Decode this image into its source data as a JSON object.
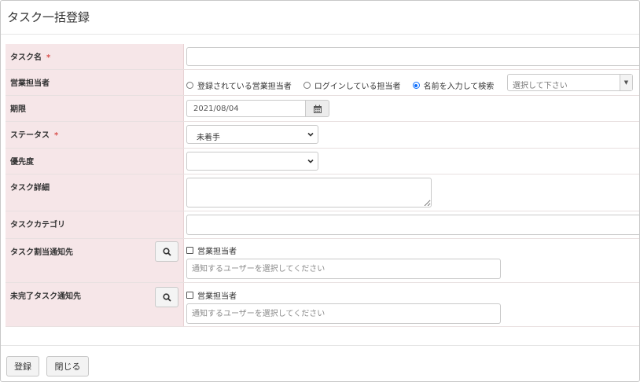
{
  "dialog": {
    "title": "タスク一括登録"
  },
  "form": {
    "task_name": {
      "label": "タスク名",
      "required_mark": "*",
      "value": ""
    },
    "sales_rep": {
      "label": "営業担当者",
      "options": [
        "登録されている営業担当者",
        "ログインしている担当者",
        "名前を入力して検索"
      ],
      "selected_index": 2,
      "combo_placeholder": "選択して下さい"
    },
    "due": {
      "label": "期限",
      "value": "2021/08/04",
      "icon": "calendar-icon"
    },
    "status": {
      "label": "ステータス",
      "required_mark": "*",
      "value": "未着手"
    },
    "priority": {
      "label": "優先度",
      "value": ""
    },
    "detail": {
      "label": "タスク詳細",
      "value": ""
    },
    "category": {
      "label": "タスクカテゴリ",
      "value": ""
    },
    "assign_notify": {
      "label": "タスク割当通知先",
      "checkbox_label": "営業担当者",
      "placeholder": "通知するユーザーを選択してください",
      "icon": "search-icon"
    },
    "incomplete_notify": {
      "label": "未完了タスク通知先",
      "checkbox_label": "営業担当者",
      "placeholder": "通知するユーザーを選択してください",
      "icon": "search-icon"
    }
  },
  "footer": {
    "register_label": "登録",
    "close_label": "閉じる"
  }
}
